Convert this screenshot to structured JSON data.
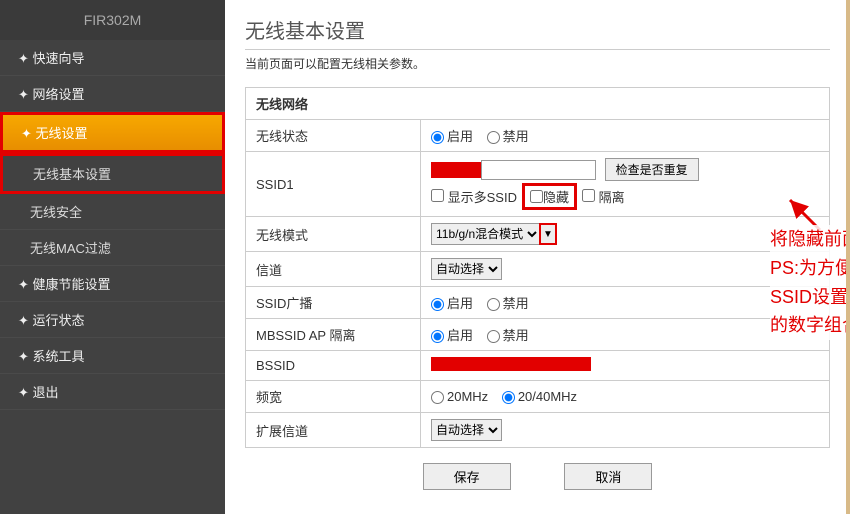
{
  "sidebar": {
    "header": "FIR302M",
    "items": [
      {
        "label": "快速向导",
        "type": "item"
      },
      {
        "label": "网络设置",
        "type": "item"
      },
      {
        "label": "无线设置",
        "type": "active"
      },
      {
        "label": "无线基本设置",
        "type": "sub"
      },
      {
        "label": "无线安全",
        "type": "sub"
      },
      {
        "label": "无线MAC过滤",
        "type": "sub"
      },
      {
        "label": "健康节能设置",
        "type": "item"
      },
      {
        "label": "运行状态",
        "type": "item"
      },
      {
        "label": "系统工具",
        "type": "item"
      },
      {
        "label": "退出",
        "type": "item"
      }
    ],
    "bullet": "✦"
  },
  "main": {
    "title": "无线基本设置",
    "desc": "当前页面可以配置无线相关参数。",
    "section_header": "无线网络",
    "rows": {
      "wireless_status": "无线状态",
      "enable": "启用",
      "disable": "禁用",
      "ssid1": "SSID1",
      "check_dup": "检查是否重复",
      "show_multi": "显示多SSID",
      "hide": "隐藏",
      "isolate": "隔离",
      "mode": "无线模式",
      "mode_value": "11b/g/n混合模式",
      "channel": "信道",
      "auto_select": "自动选择",
      "ssid_broadcast": "SSID广播",
      "mbssid_ap": "MBSSID AP 隔离",
      "bssid": "BSSID",
      "bandwidth": "频宽",
      "bw20": "20MHz",
      "bw40": "20/40MHz",
      "ext_channel": "扩展信道"
    },
    "buttons": {
      "save": "保存",
      "cancel": "取消"
    }
  },
  "annotation": {
    "line1": "将隐藏前面的勾打上",
    "line2": "PS:为方便记忆可将",
    "line3": "SSID设置为自己熟知",
    "line4": "的数字组合"
  }
}
